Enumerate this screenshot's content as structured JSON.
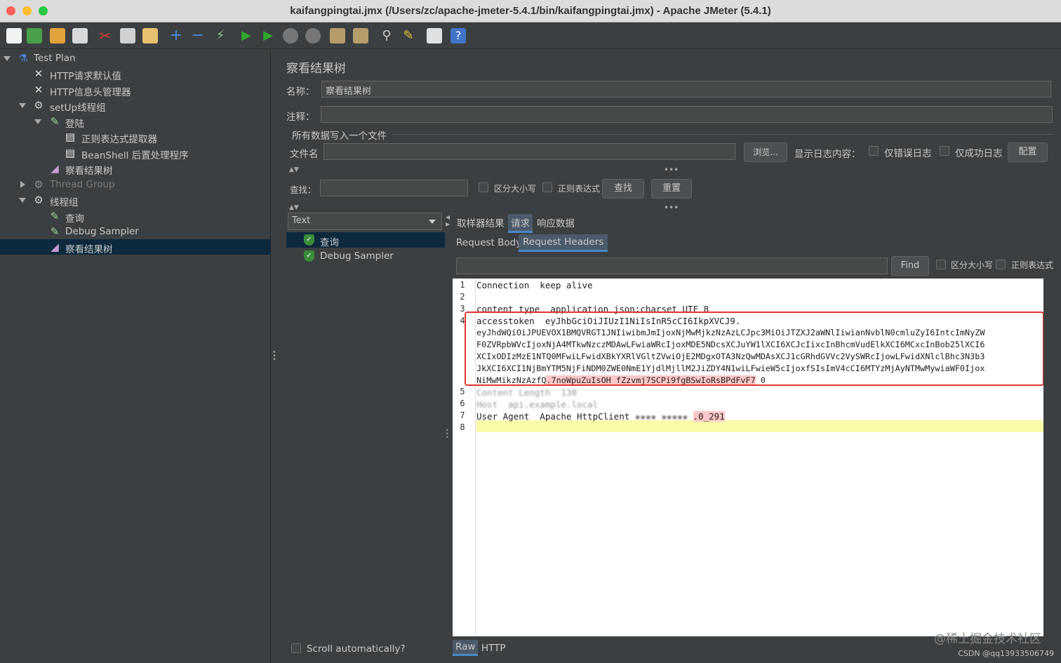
{
  "window": {
    "title": "kaifangpingtai.jmx (/Users/zc/apache-jmeter-5.4.1/bin/kaifangpingtai.jmx) - Apache JMeter (5.4.1)"
  },
  "colors": {
    "accent": "#4a88c7",
    "selection": "#0d293e",
    "highlight_box": "#e2352e",
    "panel_bg": "#3c3f41"
  },
  "toolbar": {
    "icons": [
      "new-icon",
      "templates-icon",
      "open-icon",
      "save-icon",
      "cut-icon",
      "copy-icon",
      "paste-icon",
      "expand-icon",
      "collapse-icon",
      "toggle-icon",
      "start-icon",
      "start-no-pause-icon",
      "stop-icon",
      "shutdown-icon",
      "clear-icon",
      "clear-all-icon",
      "search-icon",
      "reset-search-icon",
      "function-helper-icon",
      "help-icon"
    ]
  },
  "tree": {
    "items": [
      {
        "label": "Test Plan",
        "icon": "flask-icon"
      },
      {
        "label": "HTTP请求默认值",
        "icon": "tools-icon"
      },
      {
        "label": "HTTP信息头管理器",
        "icon": "tools-icon"
      },
      {
        "label": "setUp线程组",
        "icon": "gear-icon"
      },
      {
        "label": "登陆",
        "icon": "pen-icon"
      },
      {
        "label": "正则表达式提取器",
        "icon": "document-icon"
      },
      {
        "label": "BeanShell 后置处理程序",
        "icon": "document-icon"
      },
      {
        "label": "察看结果树",
        "icon": "chart-icon"
      },
      {
        "label": "Thread Group",
        "icon": "gear-icon"
      },
      {
        "label": "线程组",
        "icon": "gear-icon"
      },
      {
        "label": "查询",
        "icon": "pen-icon"
      },
      {
        "label": "Debug Sampler",
        "icon": "pen-icon"
      },
      {
        "label": "察看结果树",
        "icon": "chart-icon"
      }
    ]
  },
  "panel": {
    "heading": "察看结果树",
    "name_label": "名称：",
    "name_value": "察看结果树",
    "comment_label": "注释：",
    "comment_value": "",
    "file_section": "所有数据写入一个文件",
    "filename_label": "文件名",
    "filename_value": "",
    "browse_button": "浏览...",
    "log_label": "显示日志内容：",
    "errors_only": "仅错误日志",
    "success_only": "仅成功日志",
    "configure_button": "配置",
    "search_label": "查找：",
    "case_sensitive": "区分大小写",
    "regex": "正则表达式",
    "find_button": "查找",
    "reset_button": "重置"
  },
  "results": {
    "renderer": "Text",
    "items": [
      {
        "label": "查询"
      },
      {
        "label": "Debug Sampler"
      }
    ],
    "scroll_auto": "Scroll automatically?"
  },
  "tabs": {
    "main": [
      "取样器结果",
      "请求",
      "响应数据"
    ],
    "sub": [
      "Request Body",
      "Request Headers"
    ],
    "bottom": [
      "Raw",
      "HTTP"
    ]
  },
  "editor_search": {
    "find_button": "Find",
    "case_sensitive": "区分大小写",
    "regex": "正则表达式"
  },
  "editor": {
    "line_numbers": [
      "1",
      "2",
      "3",
      "4",
      "5",
      "6",
      "7",
      "8"
    ],
    "lines": [
      "Connection  keep alive",
      "",
      "content type  application json;charset UTF 8",
      "accesstoken  eyJhbGciOiJIUzI1NiIsInR5cCI6IkpXVCJ9.",
      "eyJhdWQiOiJPUEVOX1BMQVRGT1JNIiwibmJmIjoxNjMwMjkzNzAzLCJpc3MiOiJTZXJ2aWNlIiwianNvblN0cmluZyI6IntcImNyZW",
      "F0ZVRpbWVcIjoxNjA4MTkwNzczMDAwLFwiaWRcIjoxMDE5NDcsXCJuYW1lXCI6XCJcIixcInBhcmVudElkXCI6MCxcInBob25lXCI6",
      "XCIxODIzMzE1NTQ0MFwiLFwidXBkYXRlVGltZVwiOjE2MDgxOTA3NzQwMDAsXCJ1cGRhdGVVc2VySWRcIjowLFwidXNlclBhc3N3b3",
      "JkXCI6XCI1NjBmYTM5NjFiNDM0ZWE0NmE1YjdlMjllM2JiZDY4N1wiLFwieW5cIjoxfSIsImV4cCI6MTYzMjAyNTMwMywiaWF0Ijox",
      "NiMwMikzNzAzfQ",
      ".7noWpuZuIsOH_fZzvmj7SCPi9fgBSwIoRsBPdFvF7",
      " 0",
      "Content Length  130",
      "Host  api.example.local",
      "User Agent  Apache HttpClient",
      ".0_291"
    ]
  },
  "watermark": "@稀土掘金技术社区",
  "csdn": "CSDN @qq13933506749"
}
